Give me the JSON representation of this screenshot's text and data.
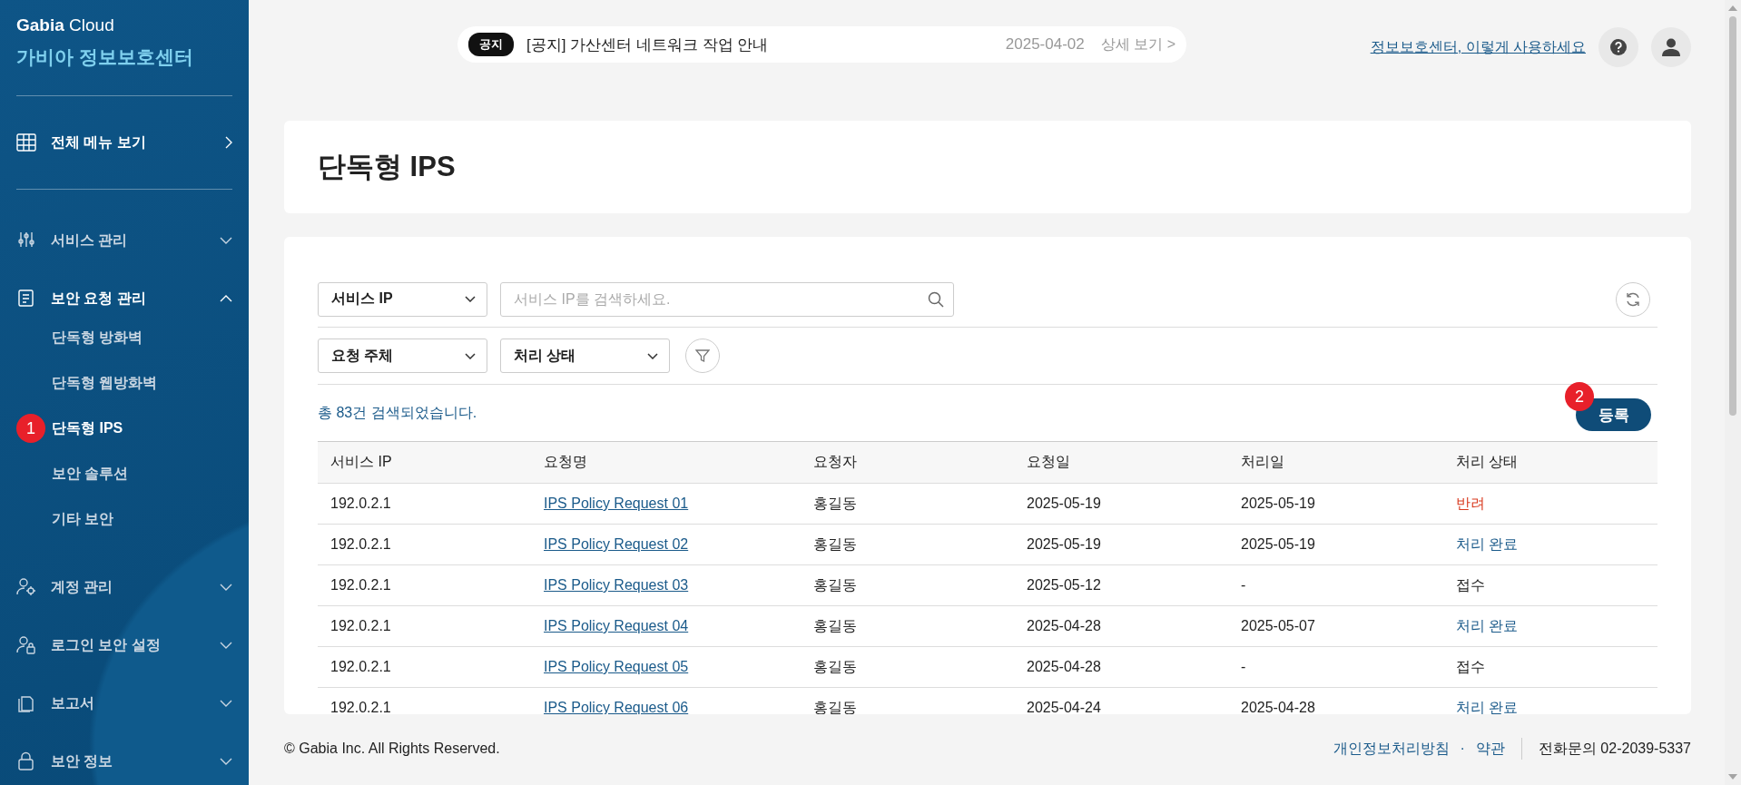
{
  "sidebar": {
    "brand": "**Gabia** Cloud",
    "subtitle": "가비아 정보보호센터",
    "all_menu": "전체 메뉴 보기",
    "groups": [
      {
        "label": "서비스 관리",
        "expanded": false
      },
      {
        "label": "보안 요청 관리",
        "expanded": true,
        "children": [
          {
            "label": "단독형 방화벽",
            "selected": false
          },
          {
            "label": "단독형 웹방화벽",
            "selected": false
          },
          {
            "label": "단독형 IPS",
            "selected": true,
            "step_badge": "1"
          },
          {
            "label": "보안 솔루션",
            "selected": false
          },
          {
            "label": "기타 보안",
            "selected": false
          }
        ]
      },
      {
        "label": "계정 관리",
        "expanded": false
      },
      {
        "label": "로그인 보안 설정",
        "expanded": false
      },
      {
        "label": "보고서",
        "expanded": false
      },
      {
        "label": "보안 정보",
        "expanded": false
      }
    ]
  },
  "notice": {
    "tag": "공지",
    "text": "[공지] 가산센터 네트워크 작업 안내",
    "date": "2025-04-02",
    "more": "상세 보기 >"
  },
  "help_link": "정보보호센터, 이렇게 사용하세요",
  "page_title": "단독형 IPS",
  "filters": {
    "search_select": "서비스 IP",
    "search_placeholder": "서비스 IP를 검색하세요.",
    "selects": [
      "요청 주체",
      "처리 상태"
    ]
  },
  "result_count": "총 83건 검색되었습니다.",
  "register_button": {
    "label": "등록",
    "step_badge": "2"
  },
  "table": {
    "columns": [
      "서비스 IP",
      "요청명",
      "요청자",
      "요청일",
      "처리일",
      "처리 상태"
    ],
    "rows": [
      {
        "service_ip": "192.0.2.1",
        "request_name": "IPS Policy Request 01",
        "requester": "홍길동",
        "request_date": "2025-05-19",
        "processed_date": "2025-05-19",
        "status": {
          "text": "반려",
          "kind": "rejected"
        }
      },
      {
        "service_ip": "192.0.2.1",
        "request_name": "IPS Policy Request 02",
        "requester": "홍길동",
        "request_date": "2025-05-19",
        "processed_date": "2025-05-19",
        "status": {
          "text": "처리 완료",
          "kind": "done"
        }
      },
      {
        "service_ip": "192.0.2.1",
        "request_name": "IPS Policy Request 03",
        "requester": "홍길동",
        "request_date": "2025-05-12",
        "processed_date": "-",
        "status": {
          "text": "접수",
          "kind": "received"
        }
      },
      {
        "service_ip": "192.0.2.1",
        "request_name": "IPS Policy Request 04",
        "requester": "홍길동",
        "request_date": "2025-04-28",
        "processed_date": "2025-05-07",
        "status": {
          "text": "처리 완료",
          "kind": "done"
        }
      },
      {
        "service_ip": "192.0.2.1",
        "request_name": "IPS Policy Request 05",
        "requester": "홍길동",
        "request_date": "2025-04-28",
        "processed_date": "-",
        "status": {
          "text": "접수",
          "kind": "received"
        }
      },
      {
        "service_ip": "192.0.2.1",
        "request_name": "IPS Policy Request 06",
        "requester": "홍길동",
        "request_date": "2025-04-24",
        "processed_date": "2025-04-28",
        "status": {
          "text": "처리 완료",
          "kind": "done"
        }
      }
    ]
  },
  "footer": {
    "copyright": "© Gabia Inc. All Rights Reserved.",
    "links": [
      "개인정보처리방침",
      "약관"
    ],
    "separator": "·",
    "phone": "전화문의 02-2039-5337"
  }
}
